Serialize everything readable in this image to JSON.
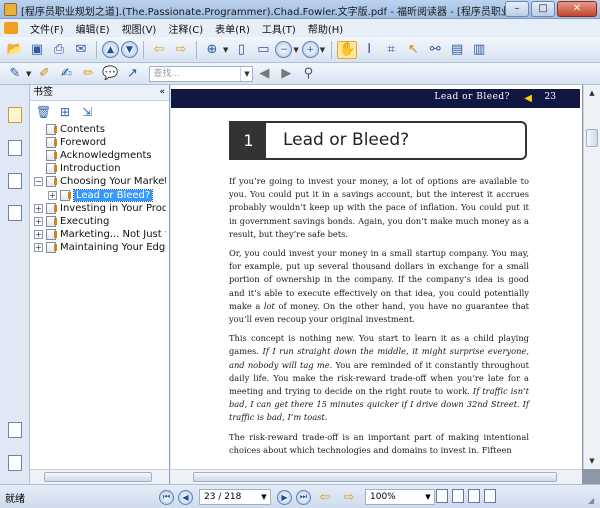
{
  "window": {
    "title": "[程序员职业规划之道].(The.Passionate.Programmer).Chad.Fowler.文字版.pdf - 福昕阅读器 - [程序员职业规划之道].(The.Pa...",
    "minimize": "–",
    "maximize": "□",
    "close": "✕"
  },
  "menu": {
    "items": [
      "文件(F)",
      "编辑(E)",
      "视图(V)",
      "注释(C)",
      "表单(R)",
      "工具(T)",
      "帮助(H)"
    ]
  },
  "toolbar2": {
    "search_placeholder": "查找..."
  },
  "panel": {
    "title": "书签",
    "collapse_glyph": "«",
    "bookmarks": [
      {
        "label": "Contents",
        "level": 0,
        "expander": ""
      },
      {
        "label": "Foreword",
        "level": 0,
        "expander": ""
      },
      {
        "label": "Acknowledgments",
        "level": 0,
        "expander": ""
      },
      {
        "label": "Introduction",
        "level": 0,
        "expander": ""
      },
      {
        "label": "Choosing Your Market",
        "level": 0,
        "expander": "−"
      },
      {
        "label": "Lead or Bleed?",
        "level": 1,
        "expander": "+"
      },
      {
        "label": "Investing in Your Product",
        "level": 0,
        "expander": "+"
      },
      {
        "label": "Executing",
        "level": 0,
        "expander": "+"
      },
      {
        "label": "Marketing... Not Just for S",
        "level": 0,
        "expander": "+"
      },
      {
        "label": "Maintaining Your Edge",
        "level": 0,
        "expander": "+"
      }
    ],
    "selected_index": 5
  },
  "document": {
    "running_head": "Lead or Bleed?",
    "running_page": "23",
    "chapter_number": "1",
    "chapter_title": "Lead or Bleed?",
    "paragraphs": [
      [
        "If you’re going to invest your money, a lot of options are available to you. You could put it in a savings account, but the interest it accrues probably wouldn’t keep up with the pace of inflation. You could put it in government savings bonds. Again, you don’t make much money as a result, but they’re safe bets."
      ],
      [
        "Or, you could invest your money in a small startup company. You may, for example, put up several thousand dollars in exchange for a small portion of ownership in the company. If the company’s idea is good and it’s able to execute effectively on that idea, you could potentially make a ",
        {
          "em": "lot"
        },
        " of money. On the other hand, you have no guarantee that you’ll even recoup your original investment."
      ],
      [
        "This concept is nothing new. You start to learn it as a child playing games. ",
        {
          "em": "If I run straight down the middle, it might surprise everyone, and nobody will tag me."
        },
        " You are reminded of it constantly throughout daily life. You make the risk-reward trade-off when you’re late for a meeting and trying to decide on the right route to work. ",
        {
          "em": "If traffic isn’t bad, I can get there 15 minutes quicker if I drive down 32nd Street. If traffic is bad, I’m toast."
        }
      ],
      [
        "The risk-reward trade-off is an important part of making intentional choices about which technologies and domains to invest in. Fifteen"
      ]
    ]
  },
  "status": {
    "text": "就绪",
    "page_display": "23 / 218",
    "zoom": "100%"
  }
}
